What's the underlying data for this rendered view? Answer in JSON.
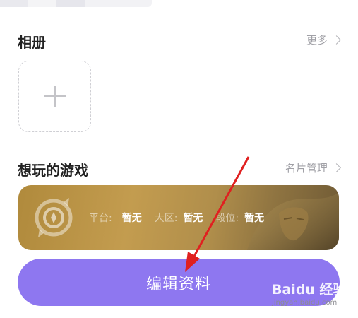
{
  "album": {
    "title": "相册",
    "more_label": "更多"
  },
  "games": {
    "title": "想玩的游戏",
    "manage_label": "名片管理",
    "card": {
      "platform_label": "平台:",
      "platform_value": "暂无",
      "region_label": "大区:",
      "region_value": "暂无",
      "rank_label": "段位:",
      "rank_value": "暂无"
    }
  },
  "edit_button": {
    "label": "编辑资料"
  },
  "watermark": {
    "brand": "Baidu 经验",
    "url": "jingyan.baidu.com"
  },
  "colors": {
    "accent": "#8e77f0",
    "card_gold": "#c39c4f",
    "arrow": "#e02020"
  },
  "icons": [
    "plus-icon",
    "chevron-right-icon",
    "game-logo-icon"
  ]
}
